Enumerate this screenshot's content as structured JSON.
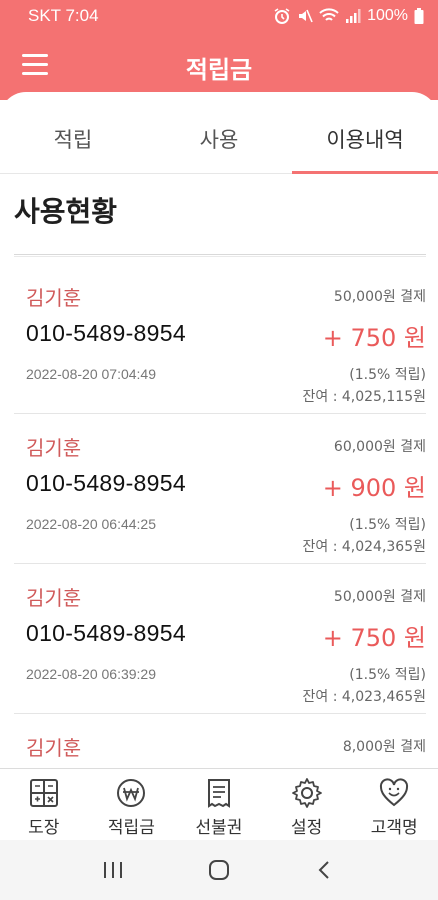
{
  "status_bar": {
    "time": "SKT 7:04",
    "battery": "100%"
  },
  "header": {
    "title": "적립금"
  },
  "tabs": [
    {
      "label": "적립"
    },
    {
      "label": "사용"
    },
    {
      "label": "이용내역",
      "active": true
    }
  ],
  "section": {
    "title": "사용현황"
  },
  "entries": [
    {
      "name": "김기훈",
      "payment": "50,000원 결제",
      "phone": "010-5489-8954",
      "points": "+ 750 원",
      "date": "2022-08-20 07:04:49",
      "rate": "(1.5% 적립)",
      "balance": "잔여 : 4,025,115원"
    },
    {
      "name": "김기훈",
      "payment": "60,000원 결제",
      "phone": "010-5489-8954",
      "points": "+ 900 원",
      "date": "2022-08-20 06:44:25",
      "rate": "(1.5% 적립)",
      "balance": "잔여 : 4,024,365원"
    },
    {
      "name": "김기훈",
      "payment": "50,000원 결제",
      "phone": "010-5489-8954",
      "points": "+ 750 원",
      "date": "2022-08-20 06:39:29",
      "rate": "(1.5% 적립)",
      "balance": "잔여 : 4,023,465원"
    },
    {
      "name": "김기훈",
      "payment": "8,000원 결제"
    }
  ],
  "bottom_nav": [
    {
      "label": "도장",
      "icon": "stamp-grid-icon"
    },
    {
      "label": "적립금",
      "icon": "won-coin-icon"
    },
    {
      "label": "선불권",
      "icon": "receipt-icon"
    },
    {
      "label": "설정",
      "icon": "gear-icon"
    },
    {
      "label": "고객명",
      "icon": "heart-face-icon"
    }
  ],
  "colors": {
    "accent": "#f47272",
    "points": "#ea5a5a",
    "name": "#d05a5a"
  }
}
